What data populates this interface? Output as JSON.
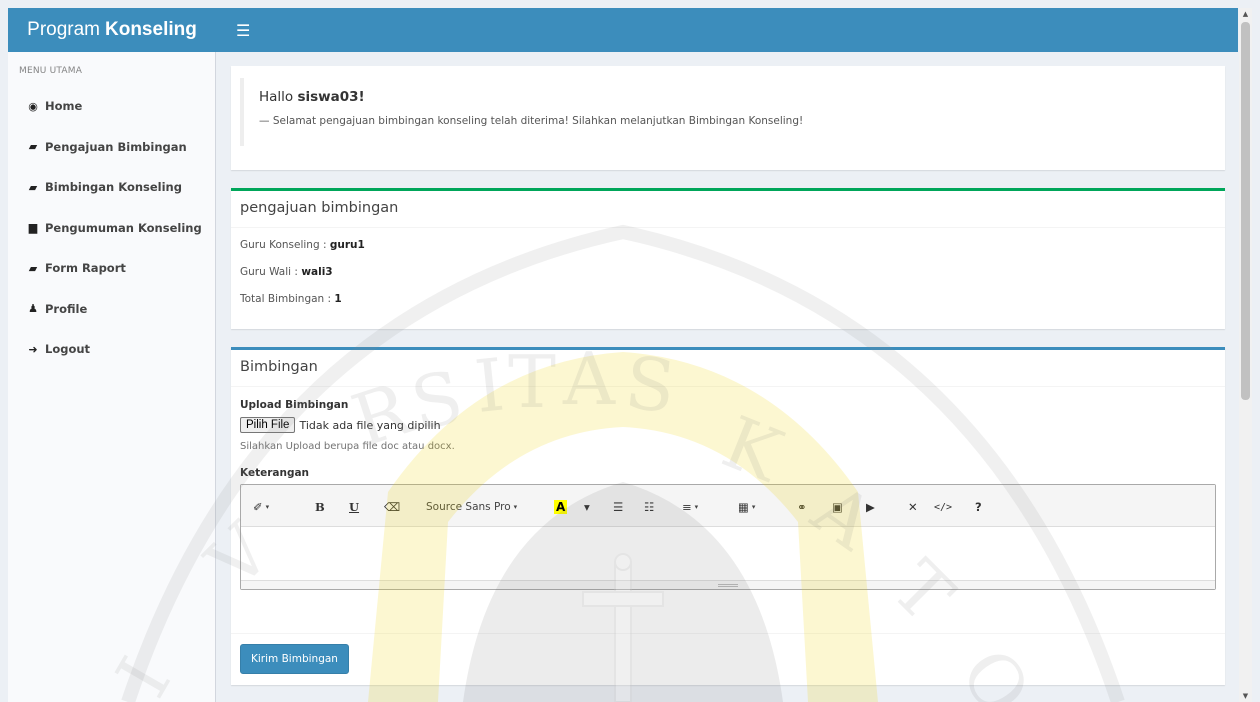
{
  "brand": {
    "light": "Program",
    "bold": "Konseling"
  },
  "header": {
    "menu_icon": "☰"
  },
  "sidebar": {
    "header": "MENU UTAMA",
    "items": [
      {
        "icon": "tachometer-icon",
        "glyph": "◉",
        "label": "Home"
      },
      {
        "icon": "book-icon",
        "glyph": "▰",
        "label": "Pengajuan Bimbingan"
      },
      {
        "icon": "book-icon",
        "glyph": "▰",
        "label": "Bimbingan Konseling"
      },
      {
        "icon": "file-icon",
        "glyph": "▆",
        "label": "Pengumuman Konseling"
      },
      {
        "icon": "book-icon",
        "glyph": "▰",
        "label": "Form Raport"
      },
      {
        "icon": "user-icon",
        "glyph": "♟",
        "label": "Profile"
      },
      {
        "icon": "sign-out-icon",
        "glyph": "➜",
        "label": "Logout"
      }
    ]
  },
  "callout": {
    "greeting": "Hallo",
    "username": "siswa03!",
    "message": "— Selamat pengajuan bimbingan konseling telah diterima! Silahkan melanjutkan Bimbingan Konseling!"
  },
  "info_box": {
    "title": "pengajuan bimbingan",
    "guru_konseling_label": "Guru Konseling :",
    "guru_konseling_value": "guru1",
    "guru_wali_label": "Guru Wali :",
    "guru_wali_value": "wali3",
    "total_label": "Total Bimbingan :",
    "total_value": "1"
  },
  "form_box": {
    "title": "Bimbingan",
    "upload_label": "Upload Bimbingan",
    "file_button": "Pilih File",
    "file_status": "Tidak ada file yang dipilih",
    "help_text": "Silahkan Upload berupa file doc atau docx.",
    "keterangan_label": "Keterangan",
    "submit_label": "Kirim Bimbingan"
  },
  "editor_toolbar": {
    "style": "✐",
    "bold": "B",
    "underline": "U",
    "eraser": "⌫",
    "font_name": "Source Sans Pro",
    "color": "A",
    "ul": "☰",
    "ol": "☷",
    "align": "≡",
    "table": "▦",
    "link": "⚭",
    "picture": "▣",
    "video": "▶",
    "fullscreen": "✕",
    "code": "</>",
    "help": "?",
    "caret": "▾"
  },
  "scrollbar": {
    "up": "▲",
    "down": "▼"
  },
  "colors": {
    "primary": "#3c8dbc",
    "success": "#00a65a",
    "content_bg": "#ecf0f5",
    "sidebar_bg": "#f9fafc"
  }
}
